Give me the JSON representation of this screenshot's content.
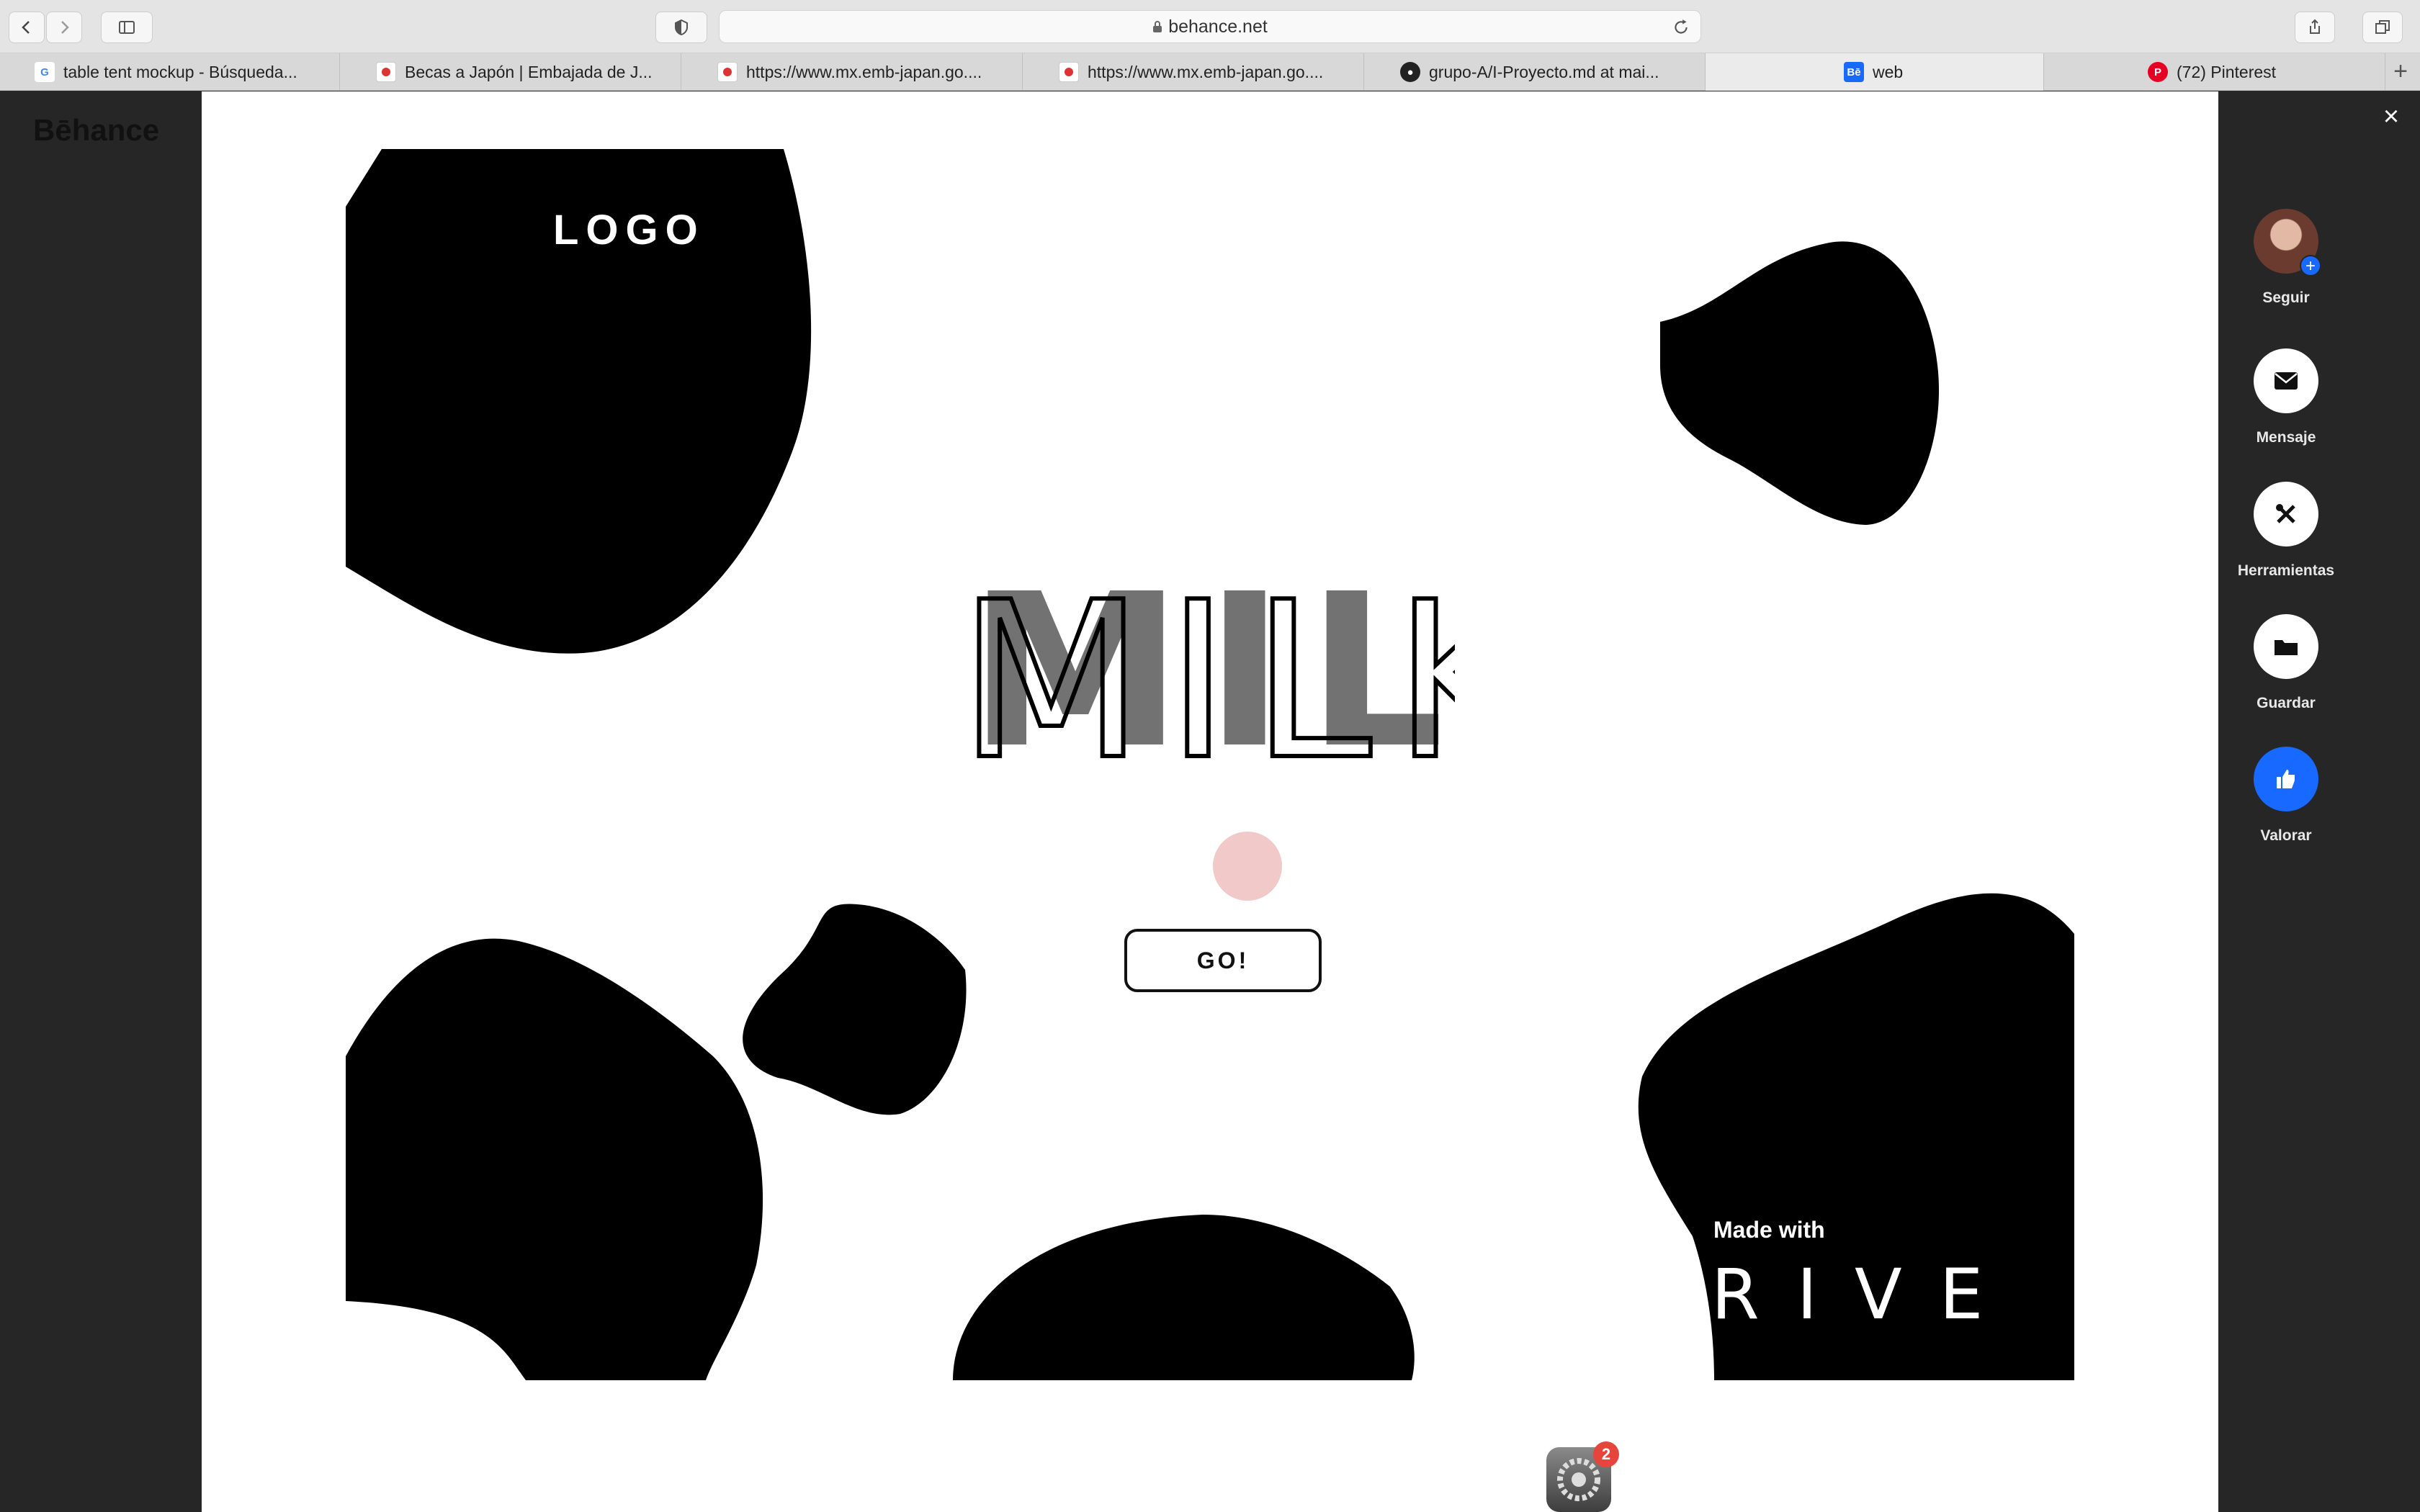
{
  "browser": {
    "url": "behance.net",
    "tabs": [
      {
        "label": "table tent mockup - Búsqueda...",
        "favicon": "google-icon"
      },
      {
        "label": "Becas a Japón | Embajada de J...",
        "favicon": "japan-flag-icon"
      },
      {
        "label": "https://www.mx.emb-japan.go....",
        "favicon": "japan-flag-icon"
      },
      {
        "label": "https://www.mx.emb-japan.go....",
        "favicon": "japan-flag-icon"
      },
      {
        "label": "grupo-A/I-Proyecto.md at mai...",
        "favicon": "github-icon"
      },
      {
        "label": "web",
        "favicon": "behance-icon",
        "active": true
      },
      {
        "label": "(72) Pinterest",
        "favicon": "pinterest-icon"
      }
    ]
  },
  "page": {
    "brand": "Bēhance"
  },
  "side_actions": {
    "follow": "Seguir",
    "message": "Mensaje",
    "tools": "Herramientas",
    "save": "Guardar",
    "appreciate": "Valorar"
  },
  "artwork": {
    "logo": "LOGO",
    "title": "MILK",
    "button": "GO!",
    "made_with": "Made with",
    "rive": "RIVE"
  },
  "dock": {
    "badge": "2"
  },
  "colors": {
    "accent": "#1769ff",
    "badge": "#e6453b"
  }
}
